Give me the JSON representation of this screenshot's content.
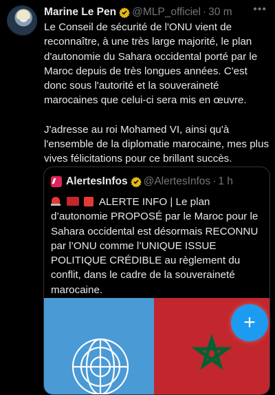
{
  "author": {
    "name": "Marine Le Pen",
    "handle": "@MLP_officiel",
    "separator": "·",
    "time": "30 m",
    "verified": true,
    "avatar_icon": "profile-photo"
  },
  "more_icon": "more-dots-icon",
  "tweet_text": {
    "paragraph1": "Le Conseil de sécurité de l'ONU vient de reconnaître, à une très large majorité, le plan d'autonomie du Sahara occidental porté par le Maroc depuis de très longues années. C'est donc sous l'autorité et la souveraineté marocaines que celui-ci sera mis en œuvre.",
    "paragraph2": "J'adresse au roi Mohamed VI, ainsi qu'à l'ensemble de la diplomatie marocaine, mes plus vives félicitations pour ce brillant succès."
  },
  "quoted": {
    "name": "AlertesInfos",
    "handle": "@AlertesInfos",
    "separator": "·",
    "time": "1 h",
    "verified": true,
    "text": "ALERTE INFO | Le plan d’autonomie PROPOSÉ par le Maroc pour le Sahara occidental est désormais RECONNU par l’ONU comme l’UNIQUE ISSUE POLITIQUE CRÉDIBLE au règlement du conflit, dans le cadre de la souveraineté marocaine.",
    "leading_emojis": [
      "rotating-light",
      "flag-morocco",
      "red-square"
    ],
    "media": [
      "flag-united-nations",
      "flag-morocco"
    ]
  },
  "fab": {
    "label": "+",
    "icon": "compose-plus-icon",
    "color": "#1d9bf0"
  },
  "colors": {
    "background": "#000000",
    "text": "#e7e9ea",
    "muted": "#71767b",
    "accent": "#1d9bf0",
    "verified_gold": "#e2b719"
  }
}
